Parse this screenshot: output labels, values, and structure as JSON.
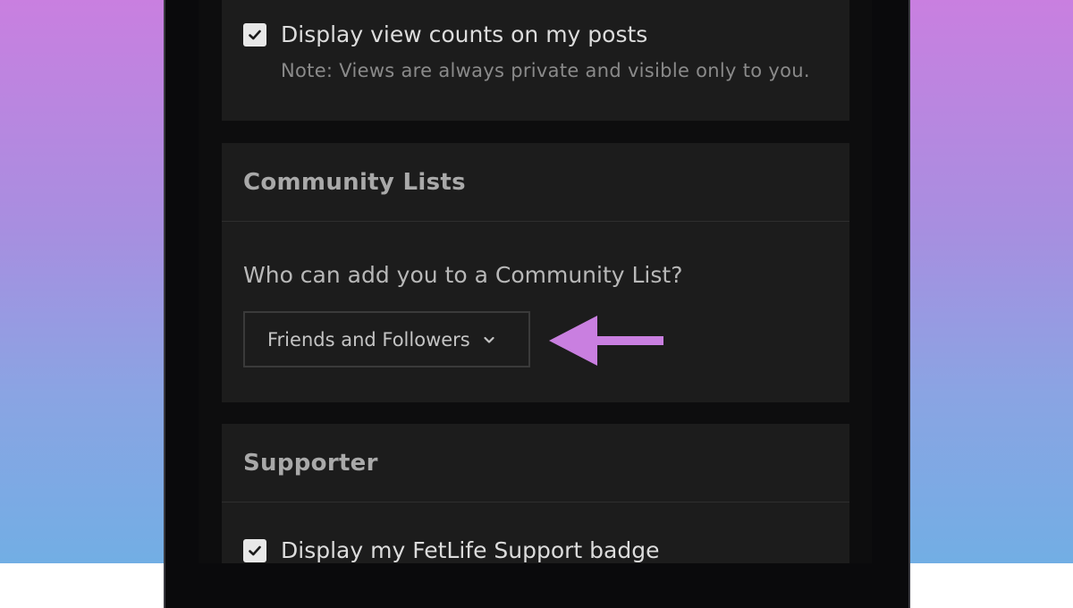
{
  "settings": {
    "view_counts": {
      "label": "Display view counts on my posts",
      "checked": true,
      "note": "Note: Views are always private and visible only to you."
    },
    "community_lists": {
      "title": "Community Lists",
      "question": "Who can add you to a Community List?",
      "selected_option": "Friends and Followers"
    },
    "supporter": {
      "title": "Supporter",
      "badge_label": "Display my FetLife Support badge",
      "checked": true
    }
  },
  "colors": {
    "accent_arrow": "#c97fe0",
    "card_bg": "#1c1c1c",
    "screen_bg": "#0d0d0e"
  },
  "icons": {
    "checkbox": "checkmark-icon",
    "select": "chevron-down-icon",
    "pointer": "arrow-left-icon"
  }
}
